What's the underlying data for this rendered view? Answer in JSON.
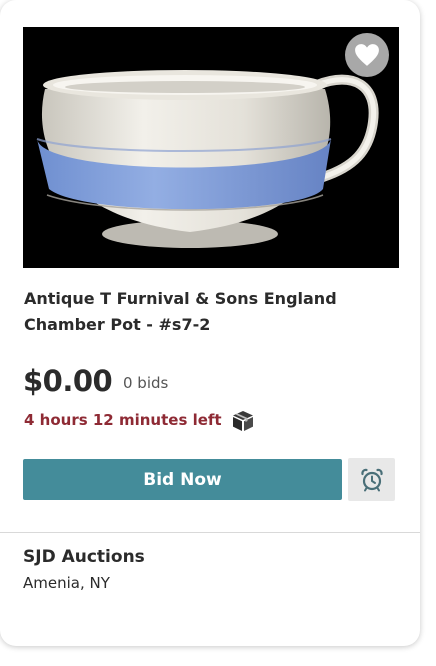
{
  "listing": {
    "image_alt": "White chamber pot with blue band",
    "title": "Antique T Furnival & Sons England Chamber Pot - #s7-2",
    "price": "$0.00",
    "bids": "0 bids",
    "time_left": "4 hours 12 minutes left",
    "bid_button_label": "Bid Now"
  },
  "icons": {
    "favorite": "heart-icon",
    "shipping": "package-icon",
    "reminder": "alarm-clock-icon"
  },
  "seller": {
    "name": "SJD Auctions",
    "location": "Amenia, NY"
  },
  "colors": {
    "bid_button": "#448c9a",
    "time_left_text": "#8e2a34",
    "photo_background": "#000000"
  }
}
